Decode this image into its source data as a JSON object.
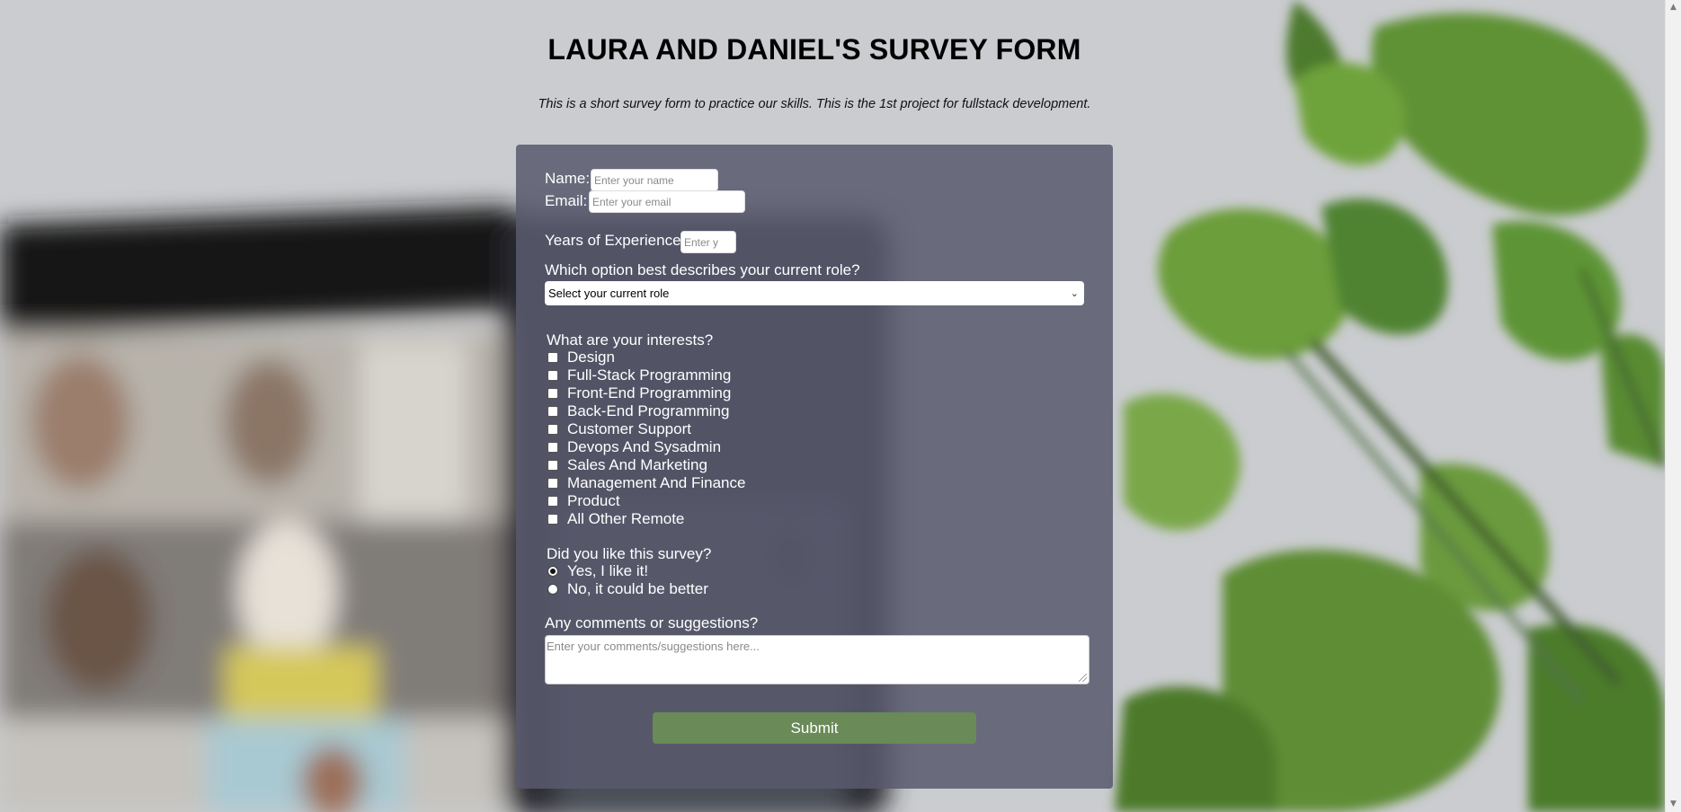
{
  "header": {
    "title": "LAURA AND DANIEL'S SURVEY FORM",
    "description": "This is a short survey form to practice our skills. This is the 1st project for fullstack development."
  },
  "form": {
    "name": {
      "label": "Name:",
      "placeholder": "Enter your name",
      "value": ""
    },
    "email": {
      "label": "Email:",
      "placeholder": "Enter your email",
      "value": ""
    },
    "years": {
      "label": "Years of Experience:",
      "placeholder": "Enter y",
      "value": ""
    },
    "role": {
      "label": "Which option best describes your current role?",
      "selected": "Select your current role"
    },
    "interests": {
      "label": "What are your interests?",
      "options": [
        "Design",
        "Full-Stack Programming",
        "Front-End Programming",
        "Back-End Programming",
        "Customer Support",
        "Devops And Sysadmin",
        "Sales And Marketing",
        "Management And Finance",
        "Product",
        "All Other Remote"
      ]
    },
    "liked": {
      "label": "Did you like this survey?",
      "options": [
        "Yes, I like it!",
        "No, it could be better"
      ],
      "selected_index": 0
    },
    "comments": {
      "label": "Any comments or suggestions?",
      "placeholder": "Enter your comments/suggestions here..."
    },
    "submit_label": "Submit"
  },
  "colors": {
    "card_background": "#585a6e",
    "submit_button": "#6a8a58",
    "page_background": "#c9cbce"
  },
  "icons": {
    "select_chevron": "chevron-down-icon",
    "scroll_up": "arrow-up-icon",
    "scroll_down": "arrow-down-icon"
  }
}
